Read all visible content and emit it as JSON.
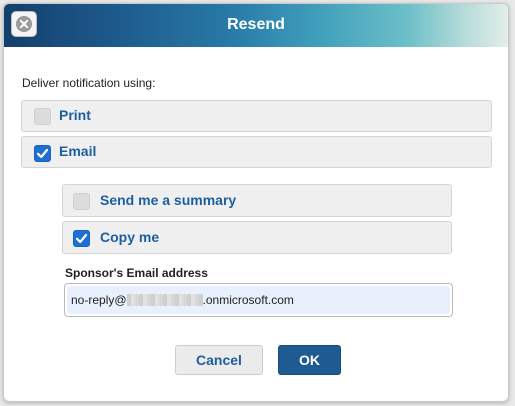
{
  "dialog": {
    "title": "Resend",
    "deliver_label": "Deliver notification using:",
    "options": [
      {
        "label": "Print",
        "checked": false
      },
      {
        "label": "Email",
        "checked": true
      }
    ],
    "email_options": [
      {
        "label": "Send me a summary",
        "checked": false
      },
      {
        "label": "Copy me",
        "checked": true
      }
    ],
    "sponsor_email_label": "Sponsor's Email address",
    "email_value_prefix": "no-reply@",
    "email_value_suffix": ".onmicrosoft.com",
    "cancel_label": "Cancel",
    "ok_label": "OK"
  },
  "colors": {
    "accent_blue": "#1d5f9e",
    "checkbox_checked": "#1e6fd0",
    "ok_button": "#1f5b91"
  },
  "icons": {
    "close": "close-icon",
    "check": "checkmark-icon"
  }
}
